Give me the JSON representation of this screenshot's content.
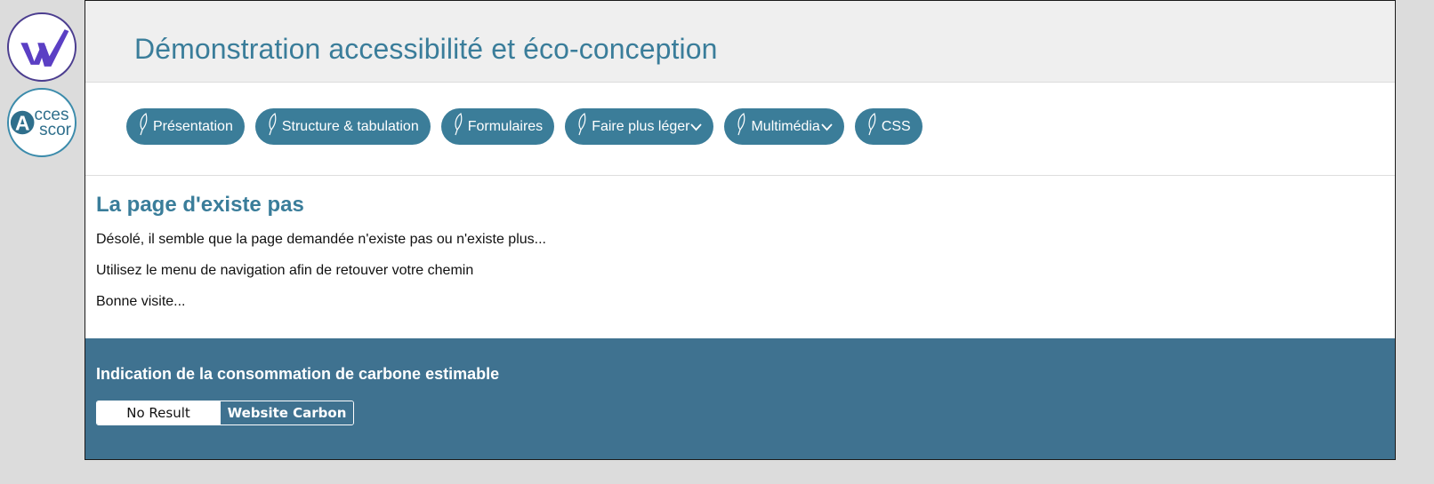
{
  "header": {
    "site_title": "Démonstration accessibilité et éco-conception"
  },
  "badges": {
    "access_score_lines": [
      "cces",
      "scor"
    ],
    "access_score_letter": "A"
  },
  "nav": {
    "items": [
      {
        "label": "Présentation",
        "icon": "leaf-icon",
        "has_dropdown": false
      },
      {
        "label": "Structure & tabulation",
        "icon": "leaf-icon",
        "has_dropdown": false
      },
      {
        "label": "Formulaires",
        "icon": "leaf-icon",
        "has_dropdown": false
      },
      {
        "label": "Faire plus léger",
        "icon": "leaf-icon",
        "has_dropdown": true
      },
      {
        "label": "Multimédia",
        "icon": "leaf-icon",
        "has_dropdown": true
      },
      {
        "label": "CSS",
        "icon": "leaf-icon",
        "has_dropdown": false
      }
    ]
  },
  "main": {
    "heading": "La page d'existe pas",
    "paragraphs": [
      "Désolé, il semble que la page demandée n'existe pas ou n'existe plus...",
      "Utilisez le menu de navigation afin de retouver votre chemin",
      "Bonne visite..."
    ]
  },
  "footer": {
    "title": "Indication de la consommation de carbone estimable",
    "carbon_result": "No Result",
    "carbon_link": "Website Carbon"
  },
  "colors": {
    "accent": "#3a7d9a",
    "nav_pill": "#3b7d99",
    "footer_bg": "#3f7290",
    "header_bg": "#efefef",
    "page_bg": "#dcdcdc"
  }
}
